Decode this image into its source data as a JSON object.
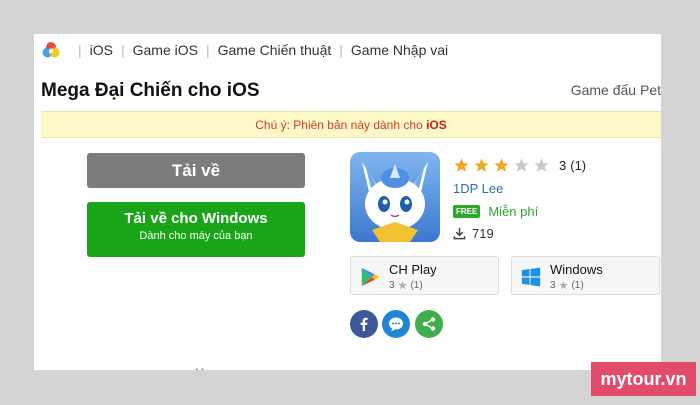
{
  "breadcrumb": {
    "items": [
      "iOS",
      "Game iOS",
      "Game Chiến thuật",
      "Game Nhập vai"
    ]
  },
  "app": {
    "title": "Mega Đại Chiến cho iOS",
    "genre": "Game đấu Pet",
    "notice_prefix": "Chú ý: Phiên bản này dành cho",
    "notice_platform": "iOS",
    "rating_value": 3,
    "rating_max": 5,
    "rating_score": "3",
    "rating_count": "(1)",
    "developer": "1DP Lee",
    "price_badge": "FREE",
    "price_label": "Miễn phí",
    "downloads": "719"
  },
  "buttons": {
    "download_label": "Tải về",
    "windows_label": "Tải về cho Windows",
    "windows_sub": "Dành cho máy của bạn"
  },
  "stores": [
    {
      "name": "CH Play",
      "score": "3",
      "count": "(1)"
    },
    {
      "name": "Windows",
      "score": "3",
      "count": "(1)"
    }
  ],
  "colors": {
    "accent_green": "#1aa519",
    "notice_bg": "#fcf8c8",
    "notice_text": "#d63a2a",
    "star": "#f5a623",
    "link": "#2b6db5",
    "watermark": "#e34b6c"
  },
  "icons": [
    "site-logo-icon",
    "star-icon",
    "download-count-icon",
    "google-play-icon",
    "windows-icon",
    "facebook-icon",
    "messenger-icon",
    "share-icon"
  ],
  "partial_text": "( )",
  "watermark": "mytour.vn"
}
